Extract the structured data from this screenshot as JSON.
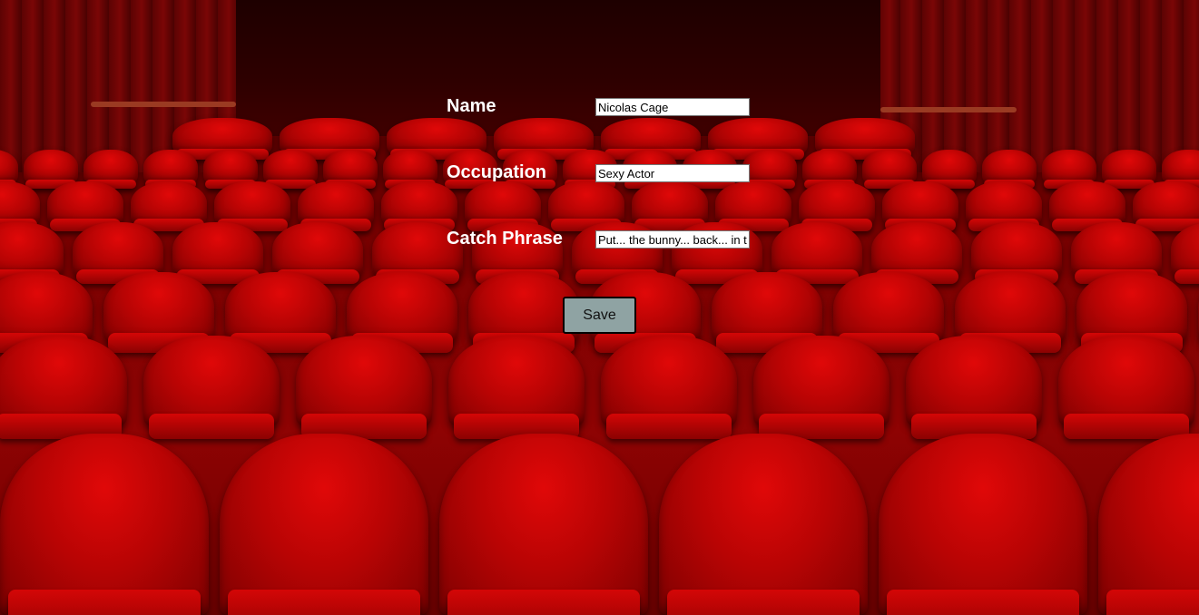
{
  "form": {
    "fields": [
      {
        "label": "Name",
        "value": "Nicolas Cage"
      },
      {
        "label": "Occupation",
        "value": "Sexy Actor"
      },
      {
        "label": "Catch Phrase",
        "value": "Put... the bunny... back... in the box."
      }
    ],
    "save_label": "Save"
  },
  "background": {
    "image": "theater-seats-background",
    "colors": {
      "seat_red": "#c80404",
      "wall": "#2e0000"
    }
  },
  "colors": {
    "label_text": "#ffffff",
    "button_bg": "#8fa3a3",
    "button_border": "#000000"
  }
}
